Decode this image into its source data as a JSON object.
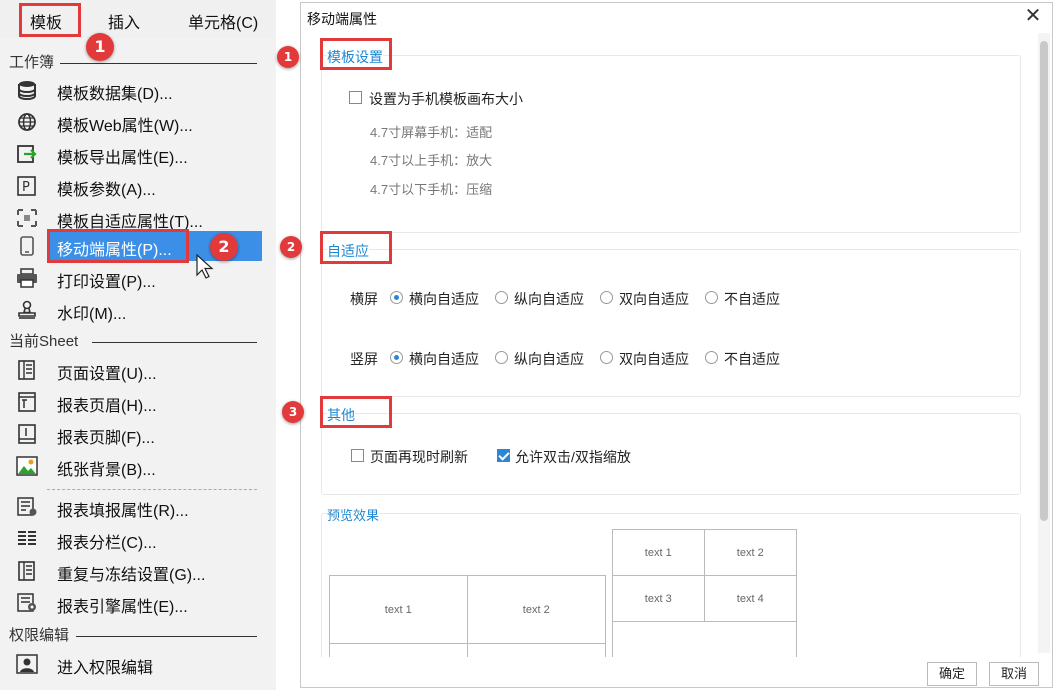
{
  "menubar": {
    "template": "模板",
    "insert": "插入",
    "cell": "单元格(C)"
  },
  "menu": {
    "workbook_section": "工作簿",
    "workbook_items": [
      {
        "label": "模板数据集(D)...",
        "icon": "database-icon"
      },
      {
        "label": "模板Web属性(W)...",
        "icon": "globe-icon"
      },
      {
        "label": "模板导出属性(E)...",
        "icon": "export-icon"
      },
      {
        "label": "模板参数(A)...",
        "icon": "parameter-icon"
      },
      {
        "label": "模板自适应属性(T)...",
        "icon": "adaptive-icon"
      },
      {
        "label": "移动端属性(P)...",
        "icon": "mobile-icon"
      },
      {
        "label": "打印设置(P)...",
        "icon": "printer-icon"
      },
      {
        "label": "水印(M)...",
        "icon": "watermark-icon"
      }
    ],
    "sheet_section": "当前Sheet",
    "sheet_items": [
      {
        "label": "页面设置(U)...",
        "icon": "page-setup-icon"
      },
      {
        "label": "报表页眉(H)...",
        "icon": "header-icon"
      },
      {
        "label": "报表页脚(F)...",
        "icon": "footer-icon"
      },
      {
        "label": "纸张背景(B)...",
        "icon": "image-icon"
      }
    ],
    "sheet_items2": [
      {
        "label": "报表填报属性(R)...",
        "icon": "fill-attr-icon"
      },
      {
        "label": "报表分栏(C)...",
        "icon": "columns-icon"
      },
      {
        "label": "重复与冻结设置(G)...",
        "icon": "freeze-icon"
      },
      {
        "label": "报表引擎属性(E)...",
        "icon": "engine-icon"
      }
    ],
    "perm_section": "权限编辑",
    "perm_items": [
      {
        "label": "进入权限编辑",
        "icon": "permission-icon"
      }
    ]
  },
  "callouts": {
    "menu_1": "1",
    "menu_2": "2",
    "dlg_1": "1",
    "dlg_2": "2",
    "dlg_3": "3"
  },
  "dialog": {
    "title": "移动端属性",
    "template_section": {
      "title": "模板设置",
      "checkbox_label": "设置为手机模板画布大小",
      "checked": false,
      "notes": [
        "4.7寸屏幕手机：适配",
        "4.7寸以上手机：放大",
        "4.7寸以下手机：压缩"
      ]
    },
    "adaptive_section": {
      "title": "自适应",
      "rows": [
        {
          "label": "横屏",
          "options": [
            "横向自适应",
            "纵向自适应",
            "双向自适应",
            "不自适应"
          ],
          "selected": 0
        },
        {
          "label": "竖屏",
          "options": [
            "横向自适应",
            "纵向自适应",
            "双向自适应",
            "不自适应"
          ],
          "selected": 0
        }
      ]
    },
    "other_section": {
      "title": "其他",
      "refresh_label": "页面再现时刷新",
      "refresh_checked": false,
      "zoom_label": "允许双击/双指缩放",
      "zoom_checked": true
    },
    "preview": {
      "title": "预览效果",
      "landscape_cells": [
        "text 1",
        "text 2"
      ],
      "portrait_cells": [
        "text 1",
        "text 2",
        "text 3",
        "text 4"
      ]
    },
    "ok_label": "确定",
    "cancel_label": "取消"
  }
}
